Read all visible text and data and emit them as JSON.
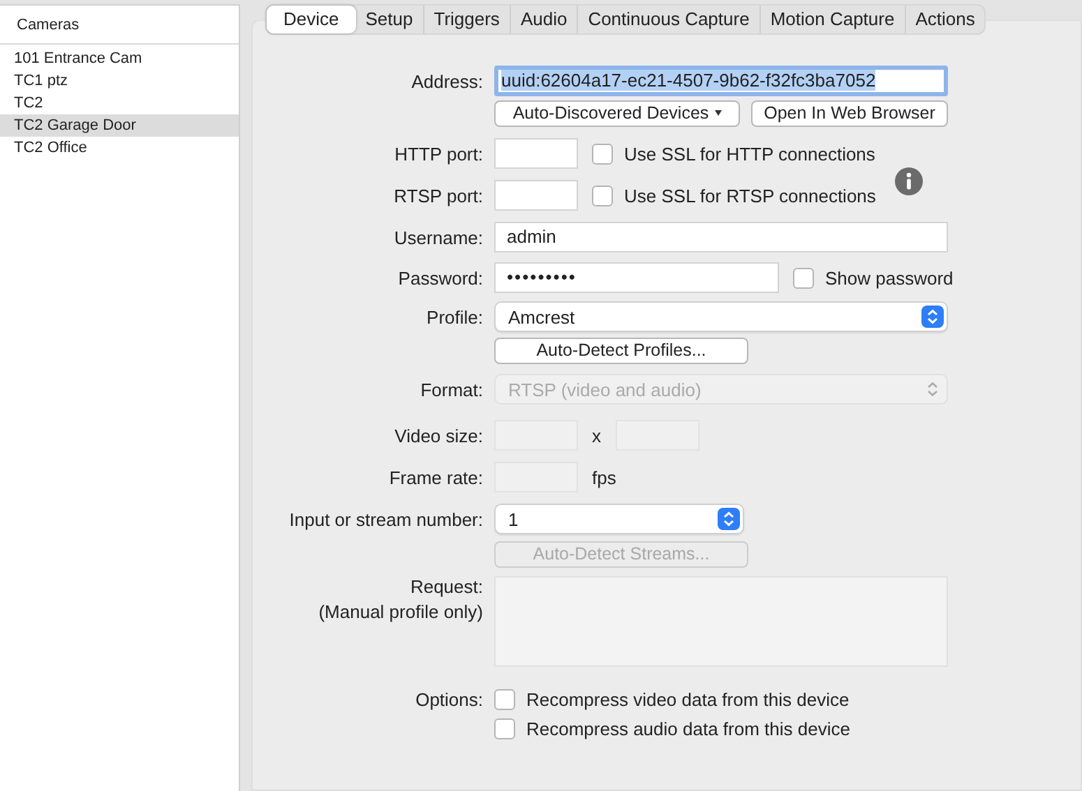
{
  "sidebar": {
    "header": "Cameras",
    "items": [
      {
        "label": "101 Entrance Cam",
        "selected": false
      },
      {
        "label": "TC1 ptz",
        "selected": false
      },
      {
        "label": "TC2",
        "selected": false
      },
      {
        "label": "TC2 Garage Door",
        "selected": true
      },
      {
        "label": "TC2 Office",
        "selected": false
      }
    ]
  },
  "tabs": [
    {
      "label": "Device",
      "selected": true
    },
    {
      "label": "Setup",
      "selected": false
    },
    {
      "label": "Triggers",
      "selected": false
    },
    {
      "label": "Audio",
      "selected": false
    },
    {
      "label": "Continuous Capture",
      "selected": false
    },
    {
      "label": "Motion Capture",
      "selected": false
    },
    {
      "label": "Actions",
      "selected": false
    }
  ],
  "form": {
    "address": {
      "label": "Address:",
      "value": "uuid:62604a17-ec21-4507-9b62-f32fc3ba7052"
    },
    "discover_button": {
      "label": "Auto-Discovered Devices"
    },
    "browser_button": {
      "label": "Open In Web Browser"
    },
    "http_port": {
      "label": "HTTP port:",
      "ssl_label": "Use SSL for HTTP connections",
      "ssl_checked": false
    },
    "rtsp_port": {
      "label": "RTSP port:",
      "ssl_label": "Use SSL for RTSP connections",
      "ssl_checked": false
    },
    "username": {
      "label": "Username:",
      "value": "admin"
    },
    "password": {
      "label": "Password:",
      "value": "•••••••••",
      "show_label": "Show password",
      "show_checked": false
    },
    "profile": {
      "label": "Profile:",
      "value": "Amcrest"
    },
    "profiles_button": {
      "label": "Auto-Detect Profiles...",
      "disabled": false
    },
    "format": {
      "label": "Format:",
      "value": "RTSP (video and audio)",
      "disabled": true
    },
    "video_size": {
      "label": "Video size:",
      "separator": "x",
      "disabled": true
    },
    "frame_rate": {
      "label": "Frame rate:",
      "unit": "fps",
      "disabled": true
    },
    "stream": {
      "label": "Input or stream number:",
      "value": "1"
    },
    "streams_button": {
      "label": "Auto-Detect Streams...",
      "disabled": true
    },
    "request": {
      "label": "Request:",
      "note": "(Manual profile only)",
      "disabled": true
    },
    "options": {
      "label": "Options:",
      "items": [
        {
          "label": "Recompress video data from this device",
          "checked": false
        },
        {
          "label": "Recompress audio data from this device",
          "checked": false
        }
      ]
    }
  }
}
